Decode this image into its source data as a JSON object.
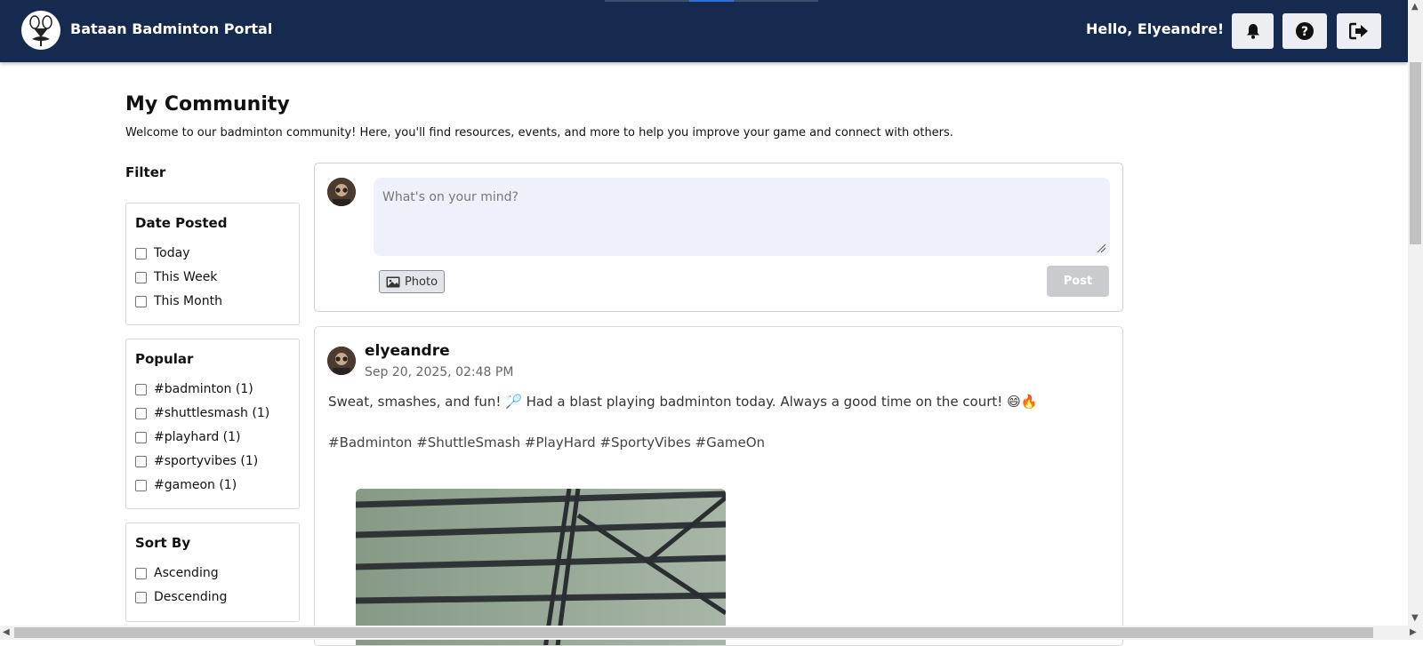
{
  "header": {
    "brand": "Bataan Badminton Portal",
    "greeting": "Hello, Elyeandre!",
    "buttons": [
      {
        "icon": "bell-icon"
      },
      {
        "icon": "question-icon"
      },
      {
        "icon": "logout-icon"
      }
    ],
    "colors": {
      "bar": "#16294f",
      "button": "#eceef2"
    }
  },
  "main": {
    "title": "My Community",
    "description": "Welcome to our badminton community! Here, you'll find resources, events, and more to help you improve your game and connect with others."
  },
  "filter": {
    "title": "Filter",
    "date_posted": {
      "title": "Date Posted",
      "options": [
        "Today",
        "This Week",
        "This Month"
      ]
    },
    "popular": {
      "title": "Popular",
      "options": [
        "#badminton (1)",
        "#shuttlesmash (1)",
        "#playhard (1)",
        "#sportyvibes (1)",
        "#gameon (1)"
      ]
    },
    "sort_by": {
      "title": "Sort By",
      "options": [
        "Ascending",
        "Descending"
      ]
    }
  },
  "composer": {
    "placeholder": "What's on your mind?",
    "photo_label": "Photo",
    "post_label": "Post"
  },
  "post": {
    "username": "elyeandre",
    "date": "Sep 20, 2025, 02:48 PM",
    "body": "Sweat, smashes, and fun! 🏸 Had a blast playing badminton today. Always a good time on the court! 😄🔥",
    "tags": "#Badminton #ShuttleSmash #PlayHard #SportyVibes #GameOn"
  }
}
